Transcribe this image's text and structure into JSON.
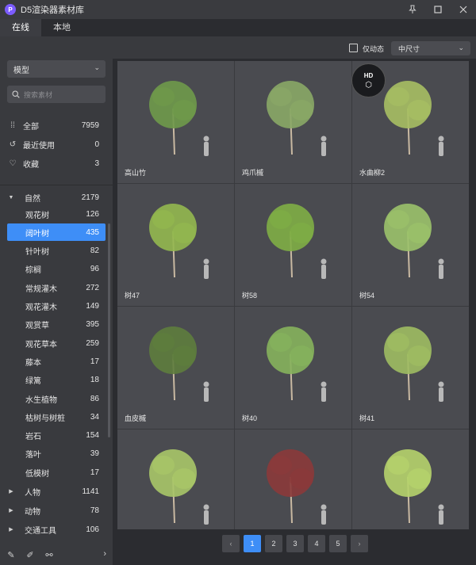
{
  "app": {
    "logo_glyph": "P",
    "title": "D5渲染器素材库"
  },
  "window_controls": {
    "pin": "⚲",
    "maximize": "☐",
    "close": "✕"
  },
  "tabs": [
    {
      "label": "在线",
      "active": true
    },
    {
      "label": "本地",
      "active": false
    }
  ],
  "sidebar": {
    "model_dropdown": "模型",
    "search_placeholder": "搜索素材",
    "quick": [
      {
        "icon": "grid-icon",
        "glyph": "⁞⁞",
        "label": "全部",
        "count": "7959"
      },
      {
        "icon": "history-icon",
        "glyph": "↺",
        "label": "最近使用",
        "count": "0"
      },
      {
        "icon": "heart-icon",
        "glyph": "♡",
        "label": "收藏",
        "count": "3"
      }
    ],
    "root": {
      "label": "自然",
      "count": "2179"
    },
    "categories": [
      {
        "label": "观花树",
        "count": "126"
      },
      {
        "label": "阔叶树",
        "count": "435",
        "selected": true
      },
      {
        "label": "针叶树",
        "count": "82"
      },
      {
        "label": "棕榈",
        "count": "96"
      },
      {
        "label": "常规灌木",
        "count": "272"
      },
      {
        "label": "观花灌木",
        "count": "149"
      },
      {
        "label": "观赏草",
        "count": "395"
      },
      {
        "label": "观花草本",
        "count": "259"
      },
      {
        "label": "藤本",
        "count": "17"
      },
      {
        "label": "绿篱",
        "count": "18"
      },
      {
        "label": "水生植物",
        "count": "86"
      },
      {
        "label": "枯树与树桩",
        "count": "34"
      },
      {
        "label": "岩石",
        "count": "154"
      },
      {
        "label": "落叶",
        "count": "39"
      },
      {
        "label": "低模树",
        "count": "17"
      }
    ],
    "groups": [
      {
        "label": "人物",
        "count": "1141"
      },
      {
        "label": "动物",
        "count": "78"
      },
      {
        "label": "交通工具",
        "count": "106"
      }
    ]
  },
  "toolbar": {
    "dynamic_only_label": "仅动态",
    "size_dropdown": "中尺寸"
  },
  "hd_badge": "HD",
  "assets": [
    {
      "label": "高山竹"
    },
    {
      "label": "鸡爪槭"
    },
    {
      "label": "水曲柳2"
    },
    {
      "label": "树47"
    },
    {
      "label": "树58"
    },
    {
      "label": "树54"
    },
    {
      "label": "血皮槭"
    },
    {
      "label": "树40"
    },
    {
      "label": "树41"
    },
    {
      "label": ""
    },
    {
      "label": ""
    },
    {
      "label": ""
    }
  ],
  "pagination": {
    "prev": "‹",
    "pages": [
      "1",
      "2",
      "3",
      "4",
      "5"
    ],
    "current": "1",
    "next": "›"
  },
  "colors": {
    "accent": "#3e8ef7",
    "panel": "#393a3e",
    "card": "#4a4b50"
  }
}
